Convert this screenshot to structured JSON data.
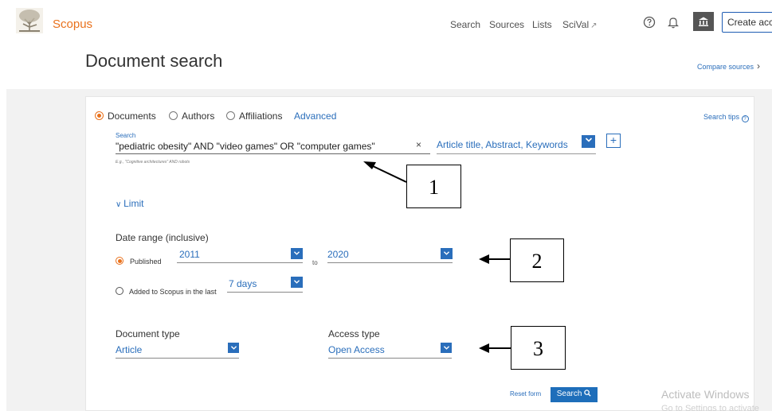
{
  "header": {
    "brand": "Scopus",
    "nav": {
      "search": "Search",
      "sources": "Sources",
      "lists": "Lists",
      "scival": "SciVal",
      "external_glyph": "↗"
    },
    "create_account": "Create acco",
    "icons": [
      "help-icon",
      "bell-icon",
      "institution-icon",
      "elsevier-tree-logo"
    ]
  },
  "page": {
    "title": "Document search",
    "compare_sources": "Compare sources",
    "compare_chevron": "›"
  },
  "search_form": {
    "radios": {
      "documents": "Documents",
      "authors": "Authors",
      "affiliations": "Affiliations",
      "selected": "documents"
    },
    "advanced": "Advanced",
    "search_tips": "Search tips",
    "search_label": "Search",
    "query": "\"pediatric obesity\" AND  \"video games\" OR \"computer games\"",
    "clear_glyph": "×",
    "example_hint": "E.g., \"Cognitive architectures\" AND robots",
    "field": "Article title, Abstract, Keywords",
    "add_glyph": "+",
    "limit": "Limit",
    "date_range_label": "Date range (inclusive)",
    "published_label": "Published",
    "published_from": "2011",
    "to_label": "to",
    "published_to": "2020",
    "added_label": "Added to Scopus in the last",
    "added_value": "7 days",
    "document_type_label": "Document type",
    "document_type": "Article",
    "access_type_label": "Access type",
    "access_type": "Open Access",
    "reset": "Reset form",
    "search_button": "Search"
  },
  "overlay": {
    "watermark_line1": "Activate Windows",
    "watermark_line2": "Go to Settings to activate",
    "callouts": [
      "1",
      "2",
      "3"
    ]
  },
  "colors": {
    "brand_orange": "#e9711c",
    "link_blue": "#2a6ebb",
    "button_blue": "#1e6eba",
    "band_gray": "#f2f2f2"
  }
}
